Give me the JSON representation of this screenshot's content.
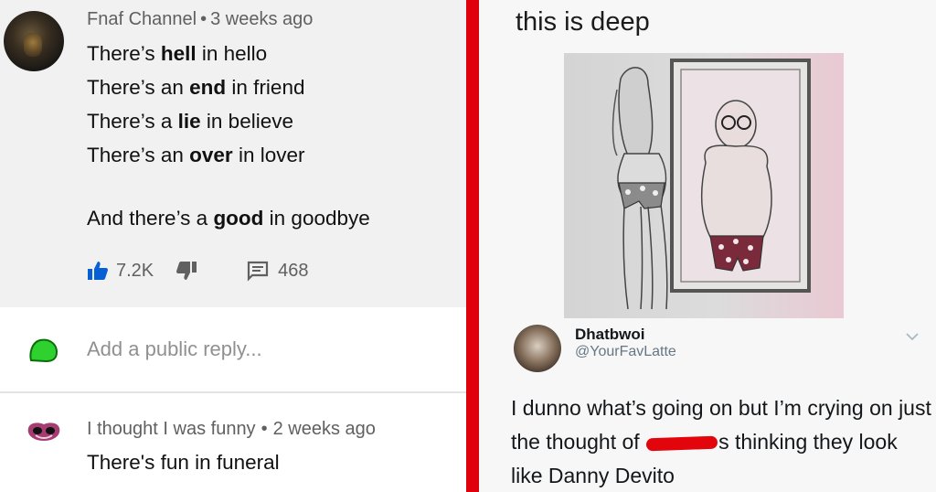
{
  "left": {
    "top_comment": {
      "author": "Fnaf Channel",
      "time": "3 weeks ago",
      "lines": [
        {
          "pre": "There’s ",
          "bold": "hell",
          "post": " in hello"
        },
        {
          "pre": "There’s an ",
          "bold": "end",
          "post": " in friend"
        },
        {
          "pre": "There’s a ",
          "bold": "lie",
          "post": " in believe"
        },
        {
          "pre": "There’s an ",
          "bold": "over",
          "post": " in lover"
        }
      ],
      "final_line": {
        "pre": "And there’s a ",
        "bold": "good",
        "post": " in goodbye"
      },
      "likes": "7.2K",
      "replies": "468",
      "icons": {
        "like": "thumbs-up-icon",
        "dislike": "thumbs-down-icon",
        "reply": "reply-icon"
      },
      "accent": "#065fd4"
    },
    "reply_box": {
      "placeholder": "Add a public reply..."
    },
    "second_comment": {
      "author": "I thought I was funny",
      "time": "2 weeks ago",
      "text": "There's fun in funeral"
    }
  },
  "divider_color": "#e0000b",
  "right": {
    "caption": "this is deep",
    "tweet": {
      "name": "Dhatbwoi",
      "handle": "@YourFavLatte",
      "text_part1": "I dunno what’s going on but I’m crying on just the thought of",
      "text_part2": "s thinking they look like Danny Devito",
      "redaction_color": "#e3050c"
    }
  }
}
